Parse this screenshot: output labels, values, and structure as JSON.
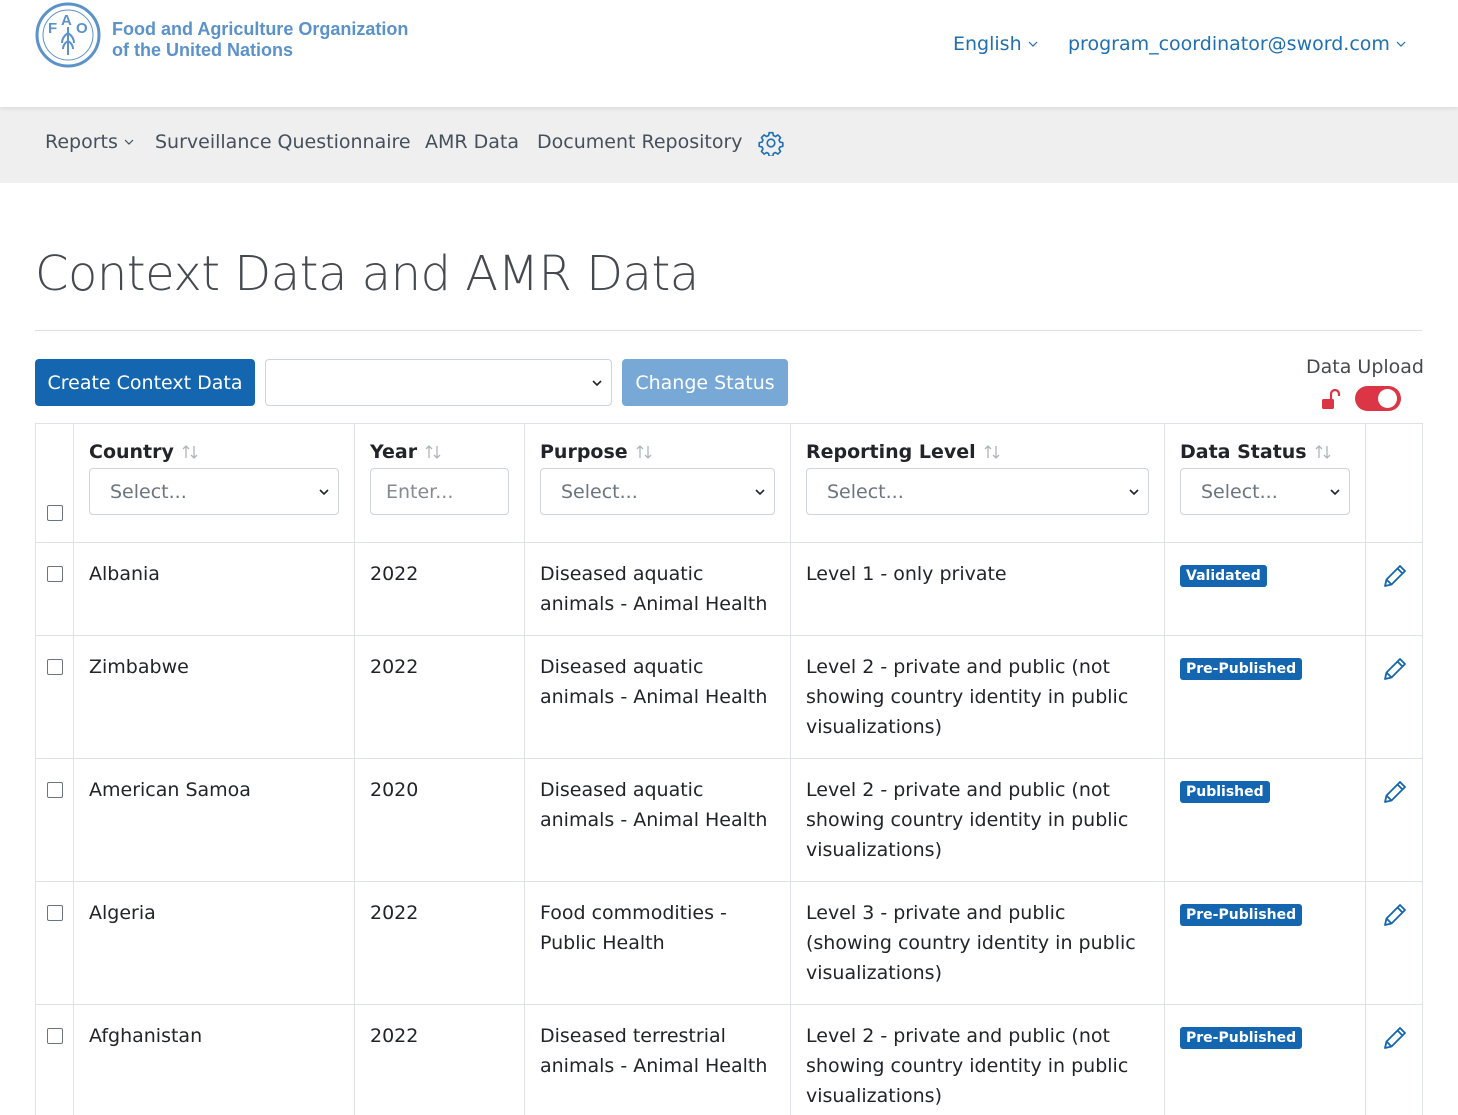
{
  "header": {
    "org_line1": "Food and Agriculture Organization",
    "org_line2": "of the United Nations",
    "language": "English",
    "user": "program_coordinator@sword.com"
  },
  "nav": {
    "reports": "Reports",
    "survey": "Surveillance Questionnaire",
    "amr": "AMR Data",
    "docs": "Document Repository"
  },
  "page": {
    "title": "Context Data and AMR Data"
  },
  "toolbar": {
    "create_label": "Create Context Data",
    "status_value": "",
    "change_label": "Change Status",
    "upload_label": "Data Upload",
    "upload_on": true
  },
  "table": {
    "columns": [
      "Country",
      "Year",
      "Purpose",
      "Reporting Level",
      "Data Status"
    ],
    "filters": {
      "country": "Select...",
      "year": "Enter...",
      "purpose": "Select...",
      "level": "Select...",
      "status": "Select..."
    },
    "rows": [
      {
        "country": "Albania",
        "year": "2022",
        "purpose": "Diseased aquatic animals - Animal Health",
        "level": "Level 1 - only private",
        "status": "Validated"
      },
      {
        "country": "Zimbabwe",
        "year": "2022",
        "purpose": "Diseased aquatic animals - Animal Health",
        "level": "Level 2 - private and public (not showing country identity in public visualizations)",
        "status": "Pre-Published"
      },
      {
        "country": "American Samoa",
        "year": "2020",
        "purpose": "Diseased aquatic animals - Animal Health",
        "level": "Level 2 - private and public (not showing country identity in public visualizations)",
        "status": "Published"
      },
      {
        "country": "Algeria",
        "year": "2022",
        "purpose": "Food commodities - Public Health",
        "level": "Level 3 - private and public (showing country identity in public visualizations)",
        "status": "Pre-Published"
      },
      {
        "country": "Afghanistan",
        "year": "2022",
        "purpose": "Diseased terrestrial animals - Animal Health",
        "level": "Level 2 - private and public (not showing country identity in public visualizations)",
        "status": "Pre-Published"
      }
    ]
  },
  "colors": {
    "primary": "#1466b0",
    "toggle_on": "#dc3545",
    "lock": "#dc3545"
  }
}
